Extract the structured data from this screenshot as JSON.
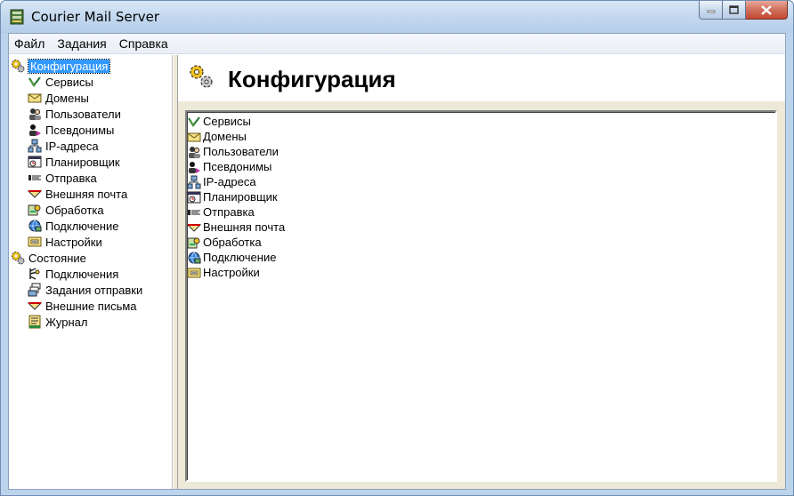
{
  "window": {
    "title": "Courier Mail Server"
  },
  "menu": [
    "Файл",
    "Задания",
    "Справка"
  ],
  "tree": {
    "config": {
      "label": "Конфигурация",
      "icon": "gears-icon",
      "children": [
        {
          "label": "Сервисы",
          "icon": "services-icon"
        },
        {
          "label": "Домены",
          "icon": "domains-icon"
        },
        {
          "label": "Пользователи",
          "icon": "users-icon"
        },
        {
          "label": "Псевдонимы",
          "icon": "aliases-icon"
        },
        {
          "label": "IP-адреса",
          "icon": "ip-addresses-icon"
        },
        {
          "label": "Планировщик",
          "icon": "scheduler-icon"
        },
        {
          "label": "Отправка",
          "icon": "sending-icon"
        },
        {
          "label": "Внешняя почта",
          "icon": "external-mail-icon"
        },
        {
          "label": "Обработка",
          "icon": "processing-icon"
        },
        {
          "label": "Подключение",
          "icon": "connection-icon"
        },
        {
          "label": "Настройки",
          "icon": "settings-icon"
        }
      ]
    },
    "status": {
      "label": "Состояние",
      "icon": "gears-icon",
      "children": [
        {
          "label": "Подключения",
          "icon": "connections-icon"
        },
        {
          "label": "Задания отправки",
          "icon": "send-jobs-icon"
        },
        {
          "label": "Внешние письма",
          "icon": "external-letters-icon"
        },
        {
          "label": "Журнал",
          "icon": "log-icon"
        }
      ]
    }
  },
  "content": {
    "title": "Конфигурация",
    "items": [
      {
        "label": "Сервисы",
        "icon": "services-icon"
      },
      {
        "label": "Домены",
        "icon": "domains-icon"
      },
      {
        "label": "Пользователи",
        "icon": "users-icon"
      },
      {
        "label": "Псевдонимы",
        "icon": "aliases-icon"
      },
      {
        "label": "IP-адреса",
        "icon": "ip-addresses-icon"
      },
      {
        "label": "Планировщик",
        "icon": "scheduler-icon"
      },
      {
        "label": "Отправка",
        "icon": "sending-icon"
      },
      {
        "label": "Внешняя почта",
        "icon": "external-mail-icon"
      },
      {
        "label": "Обработка",
        "icon": "processing-icon"
      },
      {
        "label": "Подключение",
        "icon": "connection-icon"
      },
      {
        "label": "Настройки",
        "icon": "settings-icon"
      }
    ]
  },
  "colors": {
    "selection": "#3399ff",
    "title_bar": "#c3d8ef",
    "panel": "#ece9d8"
  }
}
